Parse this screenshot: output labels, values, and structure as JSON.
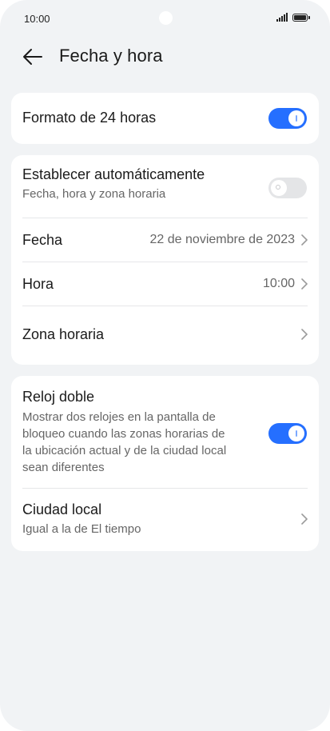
{
  "status_bar": {
    "time": "10:00",
    "signal_icon": "signal-icon",
    "battery_icon": "battery-icon"
  },
  "header": {
    "title": "Fecha y hora",
    "back_icon": "arrow-left-icon"
  },
  "card_24h": {
    "label": "Formato de 24 horas",
    "toggle_on": true
  },
  "card_datetime": {
    "auto": {
      "label": "Establecer automáticamente",
      "sub": "Fecha, hora y zona horaria",
      "toggle_on": false
    },
    "date": {
      "label": "Fecha",
      "value": "22 de noviembre de 2023"
    },
    "time": {
      "label": "Hora",
      "value": "10:00"
    },
    "timezone": {
      "label": "Zona horaria"
    }
  },
  "card_dual": {
    "dual_clock": {
      "label": "Reloj doble",
      "sub_lines": [
        "Mostrar dos relojes en la pantalla de",
        "bloqueo cuando las zonas horarias de",
        "la ubicación actual y de la ciudad local",
        "sean diferentes"
      ],
      "toggle_on": true
    },
    "home_city": {
      "label": "Ciudad local",
      "sub": "Igual a la de El tiempo"
    }
  },
  "colors": {
    "accent": "#256fff",
    "background": "#f1f3f5",
    "card": "#ffffff"
  }
}
